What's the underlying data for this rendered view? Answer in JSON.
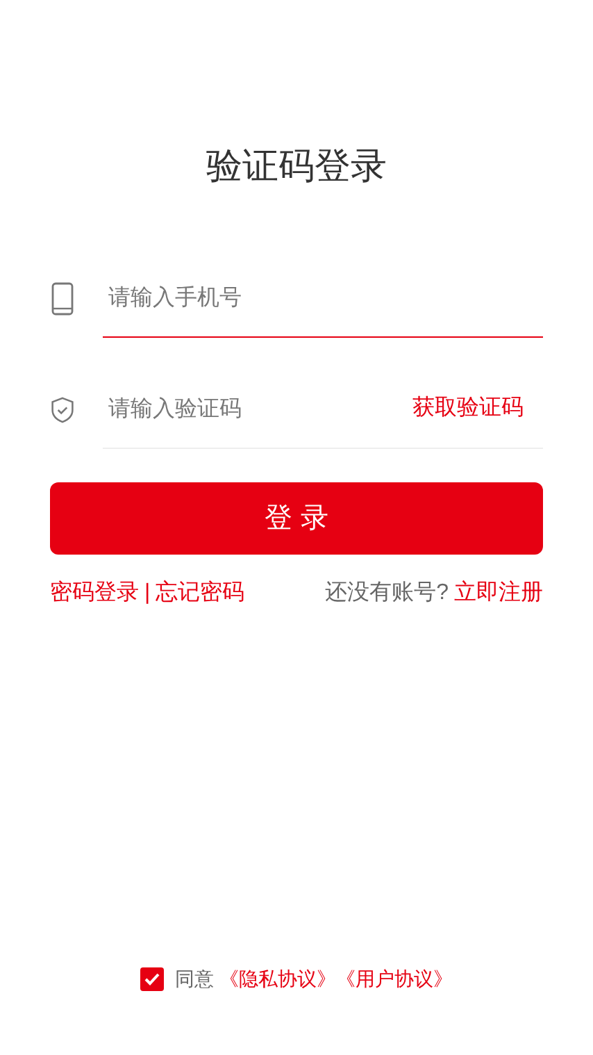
{
  "title": "验证码登录",
  "fields": [
    {
      "kind": "phone",
      "placeholder": "请输入手机号",
      "focused": true
    },
    {
      "kind": "code",
      "placeholder": "请输入验证码",
      "focused": false,
      "action": "获取验证码"
    }
  ],
  "login_button": "登 录",
  "links": {
    "password_login": "密码登录",
    "separator": "|",
    "forgot": "忘记密码",
    "no_account": "还没有账号?",
    "register": "立即注册"
  },
  "agreement": {
    "checked": true,
    "text": "同意",
    "privacy": "《隐私协议》",
    "terms": "《用户协议》"
  }
}
